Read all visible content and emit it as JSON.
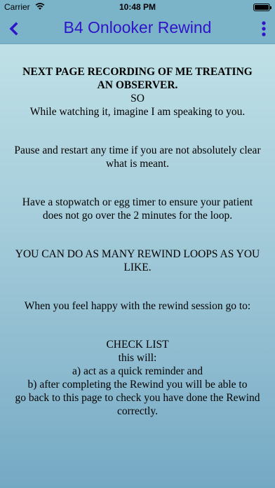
{
  "status_bar": {
    "carrier": "Carrier",
    "time": "10:48 PM"
  },
  "nav": {
    "title": "B4 Onlooker Rewind",
    "back_icon": "chevron-left-icon",
    "more_icon": "vertical-ellipsis-icon"
  },
  "content": {
    "heading_line1": "NEXT PAGE  RECORDING OF ME TREATING",
    "heading_line2": "AN OBSERVER.",
    "so": "SO",
    "watch": "While watching it, imagine I am speaking to you.",
    "pause_line1": "Pause and restart any time if you are not absolutely clear",
    "pause_line2": "what is meant.",
    "timer_line1": "Have a stopwatch or egg timer to ensure your patient",
    "timer_line2": "does not go over the 2 minutes for the loop.",
    "loops_line1": "YOU CAN DO AS MANY REWIND LOOPS AS YOU",
    "loops_line2": "LIKE.",
    "happy": "When you feel happy with the rewind session go to:",
    "checklist": "CHECK LIST",
    "this_will": "this will:",
    "item_a": "a) act as a quick reminder and",
    "item_b_line1": "b) after completing the Rewind you will be able to",
    "item_b_line2": "go back to this page to check you have done the Rewind",
    "item_b_line3": "correctly."
  },
  "colors": {
    "title": "#3014c8",
    "bar": "#7bb3c8"
  }
}
